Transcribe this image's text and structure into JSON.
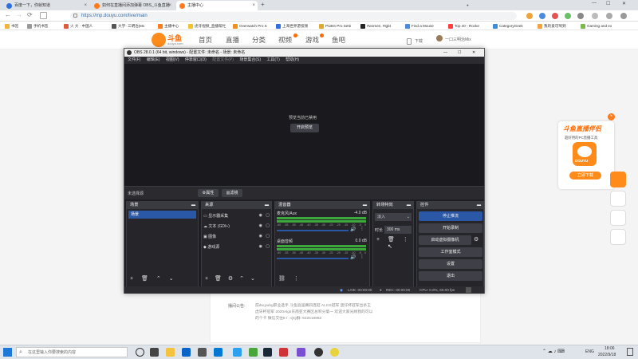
{
  "browser": {
    "tabs": [
      {
        "label": "百度一下，你就知道",
        "active": false
      },
      {
        "label": "如何在直播间添加弹幕 OBS_斗鱼直播",
        "active": false
      },
      {
        "label": "主播中心",
        "active": true
      }
    ],
    "tab_close": "×",
    "new_tab": "+",
    "url": "https://mp.douyu.com/live/main",
    "address_icons": [
      "←",
      "→",
      "⟳"
    ],
    "bookmarks": [
      "书签",
      "手机书签",
      "火 大 · 中国人",
      "大学· 三明治|Mx",
      "主播中心",
      "虎牙视频_直播帮忙",
      "Overwatch Pro S",
      "上海世界游技顿",
      "PUBG Pro Setti",
      "#women, #lgbt",
      "Find a Mouse",
      "Top 40 - Rocke",
      "CategoryGeek",
      "我的爱可驾到",
      "Gaming and ex"
    ],
    "window_controls": [
      "—",
      "☐",
      "✕"
    ]
  },
  "site": {
    "logo_text": "斗鱼",
    "logo_sub": "douyu.com",
    "nav": [
      "首页",
      "直播",
      "分类",
      "视频",
      "游戏",
      "鱼吧"
    ],
    "user_label": "一口三明治Mix",
    "download_label": "下载",
    "announcement_label": "播间公告:",
    "announcement_text": "前dw,pubg职业选手 斗鱼逍遥赛四连冠 ALGS冠军 蛋仔杯冠军出杀王 虎牙杯冠军 2020Algs东南亚大赛区总积分第一 欢迎大家光顾我的可以的个卡 微信交往8 ! : QQ群: 922516962",
    "promo_title": "斗鱼直播伴侣",
    "promo_sub": "超好用的PC直播工具",
    "promo_button": "立即下载",
    "promo_logo": "DOUYU"
  },
  "obs": {
    "title": "OBS 28.0.1 (64 bit, windows) - 配置文件: 未命名 - 场景: 未命名",
    "window_controls": [
      "—",
      "☐",
      "✕"
    ],
    "menu": [
      "文件(F)",
      "编辑(E)",
      "视图(V)",
      "停靠窗口(D)",
      "配置文件(P)",
      "场景集合(S)",
      "工具(T)",
      "帮助(H)"
    ],
    "preview_disabled": "预览当前已禁用",
    "enable_preview": "开启预览",
    "no_source": "未选择源",
    "properties": "属性",
    "filters": "滤镜",
    "docks": {
      "scenes": {
        "title": "场景",
        "items": [
          "场景"
        ]
      },
      "sources": {
        "title": "来源",
        "items": [
          "显示器采集",
          "文本 (GDI+)",
          "图像",
          "游戏源"
        ]
      },
      "mixer": {
        "title": "混音器",
        "channels": [
          {
            "name": "麦克风/Aux",
            "db": "-4.0 dB"
          },
          {
            "name": "桌面音频",
            "db": "0.0 dB"
          }
        ],
        "ticks": [
          "-60",
          "-55",
          "-50",
          "-45",
          "-40",
          "-35",
          "-30",
          "-25",
          "-20",
          "-15",
          "-10",
          "-5",
          "0"
        ]
      },
      "transitions": {
        "title": "转场特效",
        "type": "淡入",
        "duration_label": "时长",
        "duration": "300 ms"
      },
      "controls": {
        "title": "控件",
        "buttons": [
          "停止推流",
          "开始录制",
          "启动虚拟摄像机",
          "工作室模式",
          "设置",
          "退出"
        ]
      }
    },
    "status": {
      "live": "LIVE: 00:00:00",
      "rec": "REC: 00:00:00",
      "cpu": "CPU: 0.9%, 60.00 fps"
    }
  },
  "taskbar": {
    "search_placeholder": "在这里输入你要搜索的内容",
    "time": "18:06",
    "date": "2022/9/18",
    "lang": "ENG"
  },
  "colors": {
    "obs_accent": "#2a58a6",
    "meter_green": "#3ca83c",
    "douyu_orange": "#ff6a00"
  }
}
